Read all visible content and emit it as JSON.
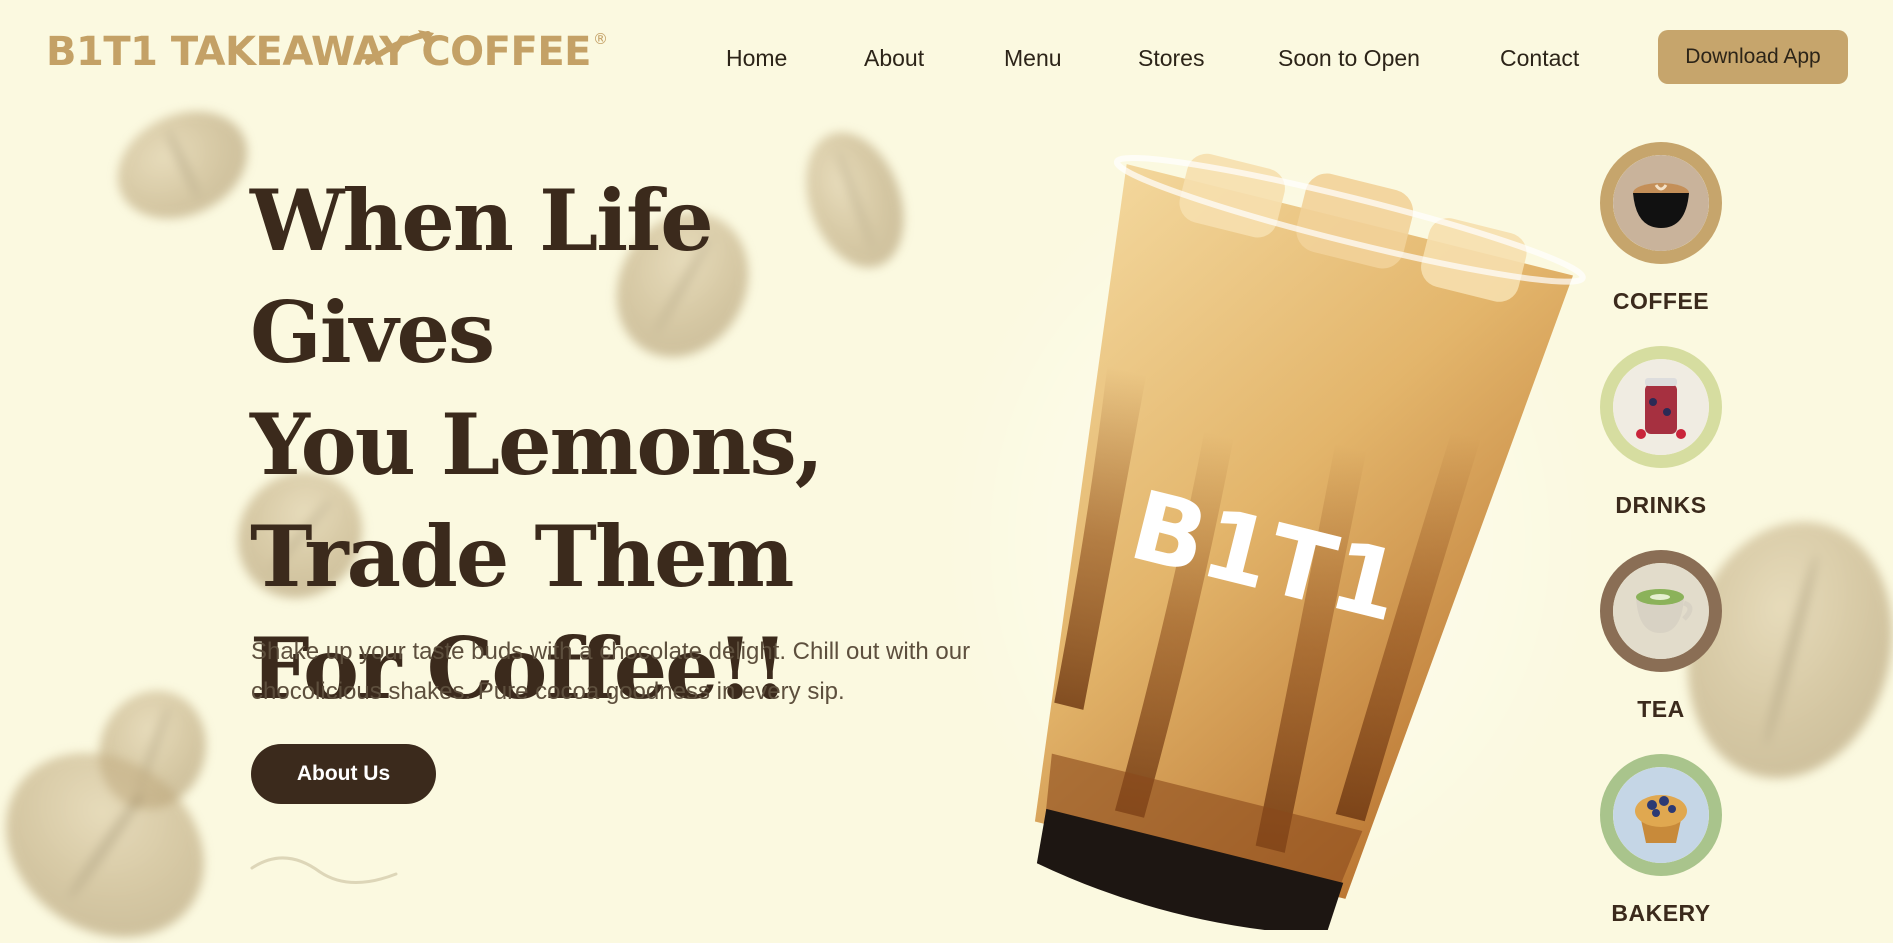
{
  "header": {
    "logo_text": "B1T1 TAKEAWAY COFFEE",
    "logo_mark": "®",
    "nav": [
      {
        "label": "Home"
      },
      {
        "label": "About"
      },
      {
        "label": "Menu"
      },
      {
        "label": "Stores"
      },
      {
        "label": "Soon to Open"
      },
      {
        "label": "Contact"
      }
    ],
    "download_label": "Download App"
  },
  "hero": {
    "title_lines": [
      "When Life Gives",
      "You Lemons,",
      "Trade Them",
      "For Coffee!!"
    ],
    "description": "Shake up your taste buds with a chocolate delight. Chill out with our chocolicious shakes. Pure cocoa goodness in every sip.",
    "cta_label": "About Us",
    "cup_brand": "B1T1"
  },
  "categories": [
    {
      "label": "COFFEE",
      "icon": "coffee-cup-icon",
      "ring": "#c6a56c"
    },
    {
      "label": "DRINKS",
      "icon": "berry-drink-jar-icon",
      "ring": "#d6dda0"
    },
    {
      "label": "TEA",
      "icon": "matcha-tea-cup-icon",
      "ring": "#8a6e55"
    },
    {
      "label": "BAKERY",
      "icon": "blueberry-muffin-icon",
      "ring": "#a9c48c"
    }
  ],
  "colors": {
    "background": "#fbf9e0",
    "brand_gold": "#c4a166",
    "button_gold": "#c6a56c",
    "dark_brown": "#3b2a1c"
  }
}
